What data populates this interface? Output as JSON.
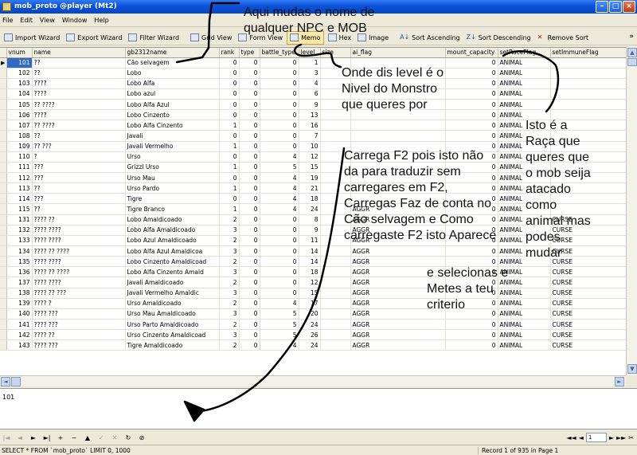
{
  "window": {
    "title": "mob_proto @player (Mt2)",
    "minimize": "–",
    "maximize": "□",
    "close": "×"
  },
  "menu": [
    "File",
    "Edit",
    "View",
    "Window",
    "Help"
  ],
  "toolbar": [
    {
      "label": "Import Wizard",
      "icon": "import-icon"
    },
    {
      "label": "Export Wizard",
      "icon": "export-icon"
    },
    {
      "label": "Filter Wizard",
      "icon": "filter-icon"
    },
    {
      "label": "Grid View",
      "icon": "grid-icon"
    },
    {
      "label": "Form View",
      "icon": "form-icon"
    },
    {
      "label": "Memo",
      "icon": "memo-icon",
      "active": true
    },
    {
      "label": "Hex",
      "icon": "hex-icon"
    },
    {
      "label": "Image",
      "icon": "image-icon"
    },
    {
      "label": "Sort Ascending",
      "icon": "sort-ascending-icon"
    },
    {
      "label": "Sort Descending",
      "icon": "sort-descending-icon"
    },
    {
      "label": "Remove Sort",
      "icon": "remove-sort-icon"
    }
  ],
  "toolbar_overflow": "»",
  "grid": {
    "columns": [
      "vnum",
      "name",
      "gb2312name",
      "rank",
      "type",
      "battle_type",
      "level",
      "size",
      "ai_flag",
      "mount_capacity",
      "setRaceFlag",
      "setImmuneFlag"
    ],
    "rows": [
      [
        "101",
        "??",
        "Cão selvagem",
        "0",
        "0",
        "0",
        "1",
        "",
        "",
        "0",
        "ANIMAL",
        ""
      ],
      [
        "102",
        "??",
        "Lobo",
        "0",
        "0",
        "0",
        "3",
        "",
        "",
        "0",
        "ANIMAL",
        ""
      ],
      [
        "103",
        "????",
        "Lobo Alfa",
        "0",
        "0",
        "0",
        "4",
        "",
        "",
        "0",
        "ANIMAL",
        ""
      ],
      [
        "104",
        "????",
        "Lobo azul",
        "0",
        "0",
        "0",
        "6",
        "",
        "",
        "0",
        "ANIMAL",
        ""
      ],
      [
        "105",
        "?? ????",
        "Lobo Alfa Azul",
        "0",
        "0",
        "0",
        "9",
        "",
        "",
        "0",
        "ANIMAL",
        ""
      ],
      [
        "106",
        "????",
        "Lobo Cinzento",
        "0",
        "0",
        "0",
        "13",
        "",
        "",
        "0",
        "ANIMAL",
        ""
      ],
      [
        "107",
        "?? ????",
        "Lobo Alfa Cinzento",
        "1",
        "0",
        "0",
        "16",
        "",
        "",
        "0",
        "ANIMAL",
        ""
      ],
      [
        "108",
        "??",
        "Javali",
        "0",
        "0",
        "0",
        "7",
        "",
        "",
        "0",
        "ANIMAL",
        ""
      ],
      [
        "109",
        "?? ???",
        "Javali Vermelho",
        "1",
        "0",
        "0",
        "10",
        "",
        "",
        "0",
        "ANIMAL",
        ""
      ],
      [
        "110",
        "?",
        "Urso",
        "0",
        "0",
        "4",
        "12",
        "",
        "",
        "0",
        "ANIMAL",
        ""
      ],
      [
        "111",
        "???",
        "Grizzl Urso",
        "1",
        "0",
        "5",
        "15",
        "",
        "",
        "0",
        "ANIMAL",
        ""
      ],
      [
        "112",
        "???",
        "Urso Mau",
        "0",
        "0",
        "4",
        "19",
        "",
        "",
        "0",
        "ANIMAL",
        ""
      ],
      [
        "113",
        "??",
        "Urso Pardo",
        "1",
        "0",
        "4",
        "21",
        "",
        "",
        "0",
        "ANIMAL",
        ""
      ],
      [
        "114",
        "???",
        "Tigre",
        "0",
        "0",
        "4",
        "18",
        "",
        "",
        "0",
        "ANIMAL",
        ""
      ],
      [
        "115",
        "??",
        "Tigre Branco",
        "1",
        "0",
        "4",
        "24",
        "",
        "AGGR",
        "0",
        "ANIMAL",
        ""
      ],
      [
        "131",
        "???? ??",
        "Lobo Amaldicoado",
        "2",
        "0",
        "0",
        "8",
        "",
        "AGGR",
        "0",
        "ANIMAL",
        "CURSE"
      ],
      [
        "132",
        "???? ????",
        "Lobo Alfa Amaldicoado",
        "3",
        "0",
        "0",
        "9",
        "",
        "AGGR",
        "0",
        "ANIMAL",
        "CURSE"
      ],
      [
        "133",
        "???? ????",
        "Lobo Azul Amaldicoado",
        "2",
        "0",
        "0",
        "11",
        "",
        "AGGR",
        "0",
        "ANIMAL",
        "CURSE"
      ],
      [
        "134",
        "???? ?? ????",
        "Lobo Alfa Azul Amaldicoa",
        "3",
        "0",
        "0",
        "14",
        "",
        "AGGR",
        "0",
        "ANIMAL",
        "CURSE"
      ],
      [
        "135",
        "???? ????",
        "Lobo Cinzento Amaldicoad",
        "2",
        "0",
        "0",
        "14",
        "",
        "AGGR",
        "0",
        "ANIMAL",
        "CURSE"
      ],
      [
        "136",
        "???? ?? ????",
        "Lobo Alfa Cinzento Amald",
        "3",
        "0",
        "0",
        "18",
        "",
        "AGGR",
        "0",
        "ANIMAL",
        "CURSE"
      ],
      [
        "137",
        "???? ????",
        "Javali Amaldicoado",
        "2",
        "0",
        "0",
        "12",
        "",
        "AGGR",
        "0",
        "ANIMAL",
        "CURSE"
      ],
      [
        "138",
        "???? ?? ???",
        "Javali Vermelho Amaldic",
        "3",
        "0",
        "0",
        "15",
        "",
        "AGGR",
        "0",
        "ANIMAL",
        "CURSE"
      ],
      [
        "139",
        "???? ?",
        "Urso Amaldicoado",
        "2",
        "0",
        "4",
        "17",
        "",
        "AGGR",
        "0",
        "ANIMAL",
        "CURSE"
      ],
      [
        "140",
        "???? ???",
        "Urso Mau Amaldicoado",
        "3",
        "0",
        "5",
        "20",
        "",
        "AGGR",
        "0",
        "ANIMAL",
        "CURSE"
      ],
      [
        "141",
        "???? ???",
        "Urso Parto Amaldicoado",
        "2",
        "0",
        "5",
        "24",
        "",
        "AGGR",
        "0",
        "ANIMAL",
        "CURSE"
      ],
      [
        "142",
        "???? ??",
        "Urso Cinzento Amaldicoad",
        "3",
        "0",
        "5",
        "26",
        "",
        "AGGR",
        "0",
        "ANIMAL",
        "CURSE"
      ],
      [
        "143",
        "???? ???",
        "Tigre Amaldicoado",
        "2",
        "0",
        "4",
        "24",
        "",
        "AGGR",
        "0",
        "ANIMAL",
        "CURSE"
      ]
    ]
  },
  "memo": {
    "value": "101"
  },
  "nav": [
    "|◄",
    "◄",
    "►",
    "►|",
    "+",
    "−",
    "▲",
    "✓",
    "✕",
    "↻",
    "⊘"
  ],
  "pagination": {
    "first": "◄◄",
    "prev": "◄",
    "page": "1",
    "next": "►",
    "last": "►►",
    "tool": "✂"
  },
  "status": {
    "sql": "SELECT * FROM `mob_proto` LIMIT 0, 1000",
    "record": "Record 1 of 935 in Page 1"
  },
  "annotations": {
    "a1": "Aqui mudas o nome de qualquer NPC e MOB",
    "a2": "Onde dis level é o Nivel do Monstro que queres por",
    "a3": "Isto é a Raça que queres que o mob seija atacado como animal mas podes mudar",
    "a4": "Carrega F2 pois isto não da para traduzir sem carregares em F2, Carregas Faz de conta no Cão selvagem e Como carregaste F2 isto Aparece",
    "a5": "e selecionas e Metes a teu criterio"
  }
}
